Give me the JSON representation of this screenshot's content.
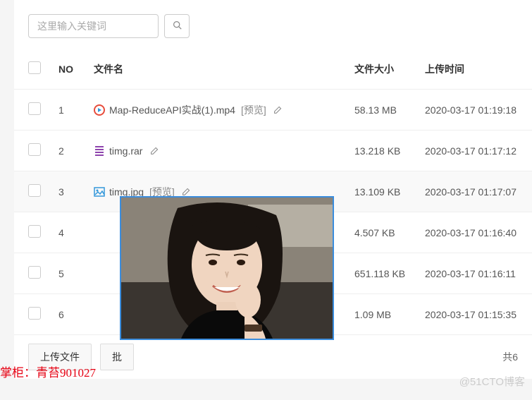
{
  "search": {
    "placeholder": "这里输入关键词"
  },
  "columns": {
    "no": "NO",
    "name": "文件名",
    "size": "文件大小",
    "time": "上传时间"
  },
  "rows": [
    {
      "no": "1",
      "name": "Map-ReduceAPI实战(1).mp4",
      "preview": "[预览]",
      "size": "58.13 MB",
      "time": "2020-03-17 01:19:18",
      "icon": "video"
    },
    {
      "no": "2",
      "name": "timg.rar",
      "preview": "",
      "size": "13.218 KB",
      "time": "2020-03-17 01:17:12",
      "icon": "rar"
    },
    {
      "no": "3",
      "name": "timg.jpg",
      "preview": "[预览]",
      "size": "13.109 KB",
      "time": "2020-03-17 01:17:07",
      "icon": "image"
    },
    {
      "no": "4",
      "name": "",
      "preview": "",
      "size": "4.507 KB",
      "time": "2020-03-17 01:16:40",
      "icon": ""
    },
    {
      "no": "5",
      "name": "",
      "preview": "",
      "size": "651.118 KB",
      "time": "2020-03-17 01:16:11",
      "icon": ""
    },
    {
      "no": "6",
      "name": "",
      "preview": "",
      "size": "1.09 MB",
      "time": "2020-03-17 01:15:35",
      "icon": ""
    }
  ],
  "footer": {
    "upload": "上传文件",
    "batch": "批",
    "total_prefix": "共6"
  },
  "watermark": {
    "red": "掌柜：青苔901027",
    "grey": "@51CTO博客"
  }
}
